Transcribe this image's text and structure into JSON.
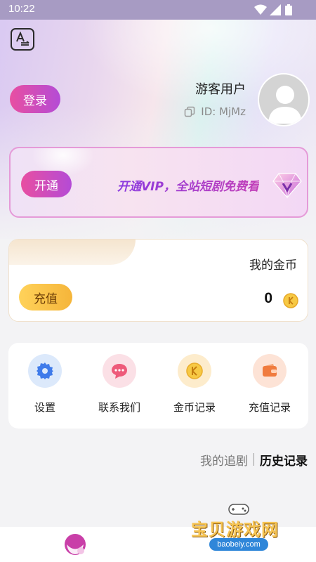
{
  "status_bar": {
    "time": "10:22"
  },
  "header": {
    "login_label": "登录",
    "user_name": "游客用户",
    "user_id": "ID: MjMz"
  },
  "vip": {
    "open_label": "开通",
    "promo_text": "开通VIP，全站短剧免费看"
  },
  "coins": {
    "title": "我的金币",
    "recharge_label": "充值",
    "value": "0"
  },
  "menu": {
    "items": [
      {
        "label": "设置",
        "icon": "gear-icon"
      },
      {
        "label": "联系我们",
        "icon": "chat-icon"
      },
      {
        "label": "金币记录",
        "icon": "coin-icon"
      },
      {
        "label": "充值记录",
        "icon": "wallet-icon"
      }
    ]
  },
  "history_tabs": {
    "following": "我的追剧",
    "history": "历史记录"
  },
  "watermark": {
    "title": "宝贝游戏网",
    "url": "baobeiy.com"
  },
  "colors": {
    "accent_pink": "#e84fa1",
    "accent_purple": "#b44bd6",
    "gold": "#f5b53a",
    "vip_text": "#9b3fd6"
  }
}
